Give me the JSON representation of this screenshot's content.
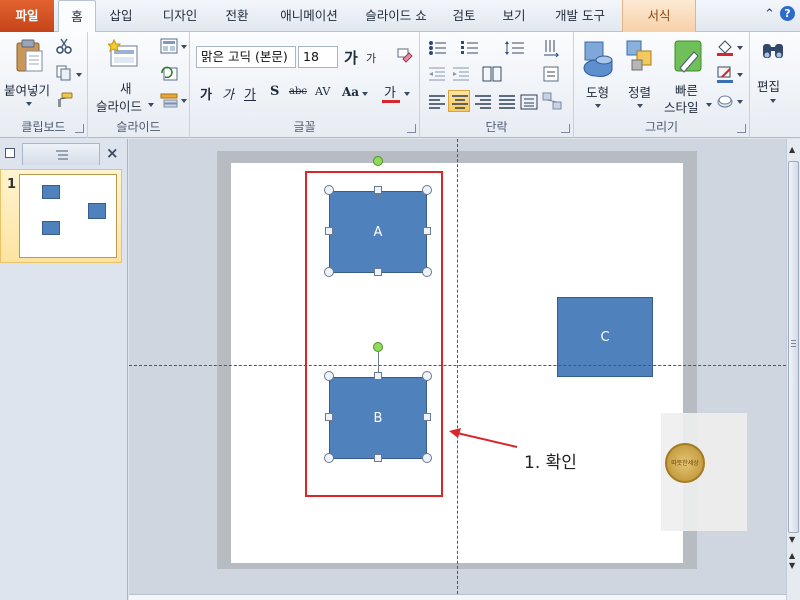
{
  "tabs": {
    "file": "파일",
    "home": "홈",
    "insert": "삽입",
    "design": "디자인",
    "transitions": "전환",
    "animations": "애니메이션",
    "slideshow": "슬라이드 쇼",
    "review": "검토",
    "view": "보기",
    "developer": "개발 도구",
    "format": "서식"
  },
  "ribbon": {
    "clipboard": {
      "paste": "붙여넣기",
      "label": "클립보드"
    },
    "slides": {
      "new_line1": "새",
      "new_line2": "슬라이드",
      "label": "슬라이드"
    },
    "font": {
      "name": "맑은 고딕 (본문)",
      "size": "18",
      "grow": "가",
      "shrink": "가",
      "bold": "가",
      "italic": "가",
      "underline": "가",
      "shadow": "S",
      "strike": "abc",
      "spacing": "AV",
      "case": "Aa",
      "color": "가",
      "label": "글꼴"
    },
    "paragraph": {
      "label": "단락"
    },
    "drawing": {
      "shapes": "도형",
      "arrange": "정렬",
      "quick_line1": "빠른",
      "quick_line2": "스타일",
      "label": "그리기"
    },
    "editing": {
      "label": "편집"
    }
  },
  "slide_panel": {
    "slide_number": "1"
  },
  "slide": {
    "shapes": [
      {
        "name": "shape-a",
        "text": "A"
      },
      {
        "name": "shape-b",
        "text": "B"
      },
      {
        "name": "shape-c",
        "text": "C"
      }
    ],
    "annotation": "1. 확인",
    "watermark": "따뜻한세상"
  },
  "colors": {
    "accent_red": "#d9262a",
    "shape_fill": "#4f81bd",
    "file_tab": "#d24e21",
    "context_tab": "#f6d1a8"
  },
  "icons": [
    "paste-icon",
    "cut-icon",
    "copy-icon",
    "format-painter-icon",
    "new-slide-icon",
    "shapes-icon",
    "arrange-icon",
    "quick-styles-icon",
    "find-icon",
    "minimize-icon",
    "help-icon"
  ]
}
